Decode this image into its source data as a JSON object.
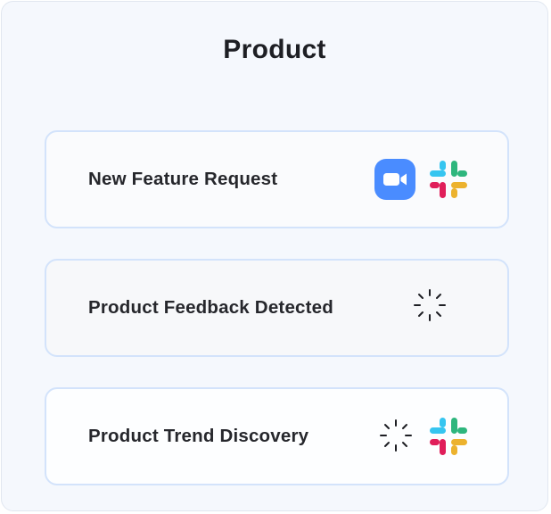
{
  "panel": {
    "title": "Product"
  },
  "cards": [
    {
      "label": "New Feature Request",
      "icons": [
        "zoom-icon",
        "slack-icon"
      ]
    },
    {
      "label": "Product Feedback Detected",
      "icons": [
        "loading-spinner-icon"
      ]
    },
    {
      "label": "Product Trend Discovery",
      "icons": [
        "loading-spinner-icon",
        "slack-icon"
      ]
    }
  ],
  "colors": {
    "zoom_blue": "#4a8cff",
    "slack_blue": "#36c5f0",
    "slack_green": "#2eb67d",
    "slack_yellow": "#ecb22e",
    "slack_red": "#e01e5a",
    "card_border": "#d3e3fb"
  }
}
